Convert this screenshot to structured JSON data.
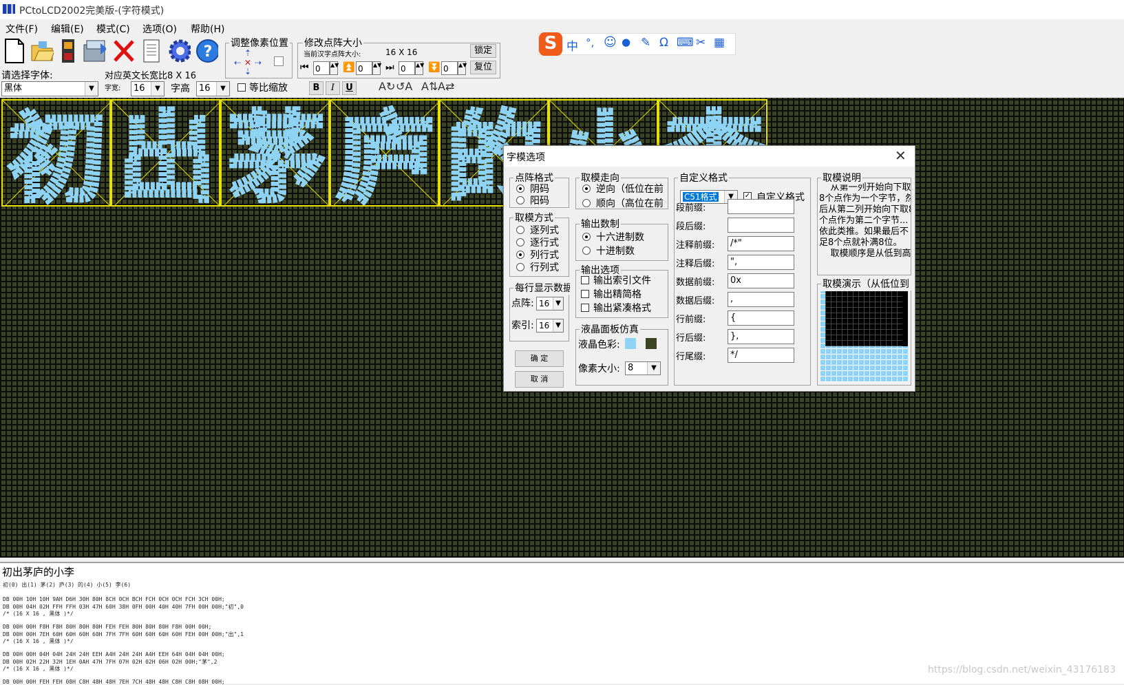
{
  "window": {
    "title": "PCtoLCD2002完美版-(字符模式)"
  },
  "menu": [
    "文件(F)",
    "编辑(E)",
    "模式(C)",
    "选项(O)",
    "帮助(H)"
  ],
  "toolbar": {
    "icons": [
      "new-file-icon",
      "open-folder-icon",
      "save-icon",
      "batch-generate-icon",
      "delete-icon",
      "document-icon",
      "settings-gear-icon",
      "help-icon"
    ],
    "adjust_pixel_title": "调整像素位置",
    "resize_title": "修改点阵大小",
    "current_size_label": "当前汉字点阵大小:",
    "current_size_value": "16 X 16",
    "lock_btn": "锁定",
    "reset_btn": "复位",
    "spin_values": [
      "0",
      "0",
      "0",
      "0"
    ],
    "font_select_label": "请选择字体:",
    "english_ratio_label": "对应英文长宽比8 X 16",
    "font_name": "黑体",
    "width_label": "字宽:",
    "width_value": "16",
    "height_label": "字高",
    "height_value": "16",
    "proportional_label": "等比缩放",
    "bold": "B",
    "italic": "I",
    "underline": "U"
  },
  "ime_bar": [
    "中",
    "°,",
    "☺",
    "🎤",
    "✎",
    "Ω",
    "⌨",
    "✂",
    "▦"
  ],
  "glyphs": [
    "初",
    "出",
    "茅",
    "庐",
    "的",
    "小",
    "李"
  ],
  "led_colors": {
    "on": "#8fd3f4",
    "off": "#3b4325",
    "frame": "#e8e000"
  },
  "dialog": {
    "title": "字模选项",
    "dot_format": {
      "title": "点阵格式",
      "options": [
        "阴码",
        "阳码"
      ],
      "selected": 0
    },
    "scan_mode": {
      "title": "取模方式",
      "options": [
        "逐列式",
        "逐行式",
        "列行式",
        "行列式"
      ],
      "selected": 2
    },
    "per_line": {
      "title": "每行显示数据",
      "dot_label": "点阵:",
      "dot_value": "16",
      "index_label": "索引:",
      "index_value": "16"
    },
    "ok": "确   定",
    "cancel": "取   消",
    "direction": {
      "title": "取模走向",
      "options": [
        "逆向（低位在前",
        "顺向（高位在前"
      ],
      "selected": 0
    },
    "number_base": {
      "title": "输出数制",
      "options": [
        "十六进制数",
        "十进制数"
      ],
      "selected": 0
    },
    "output_options": {
      "title": "输出选项",
      "options": [
        "输出索引文件",
        "输出精简格",
        "输出紧凑格式"
      ]
    },
    "lcd_sim": {
      "title": "液晶面板仿真",
      "color_label": "液晶色彩:",
      "pixel_label": "像素大小:",
      "pixel_value": "8"
    },
    "custom": {
      "title": "自定义格式",
      "format_value": "C51格式",
      "custom_check": "自定义格式",
      "rows": [
        {
          "label": "段前缀:",
          "value": ""
        },
        {
          "label": "段后缀:",
          "value": ""
        },
        {
          "label": "注释前缀:",
          "value": "/*\""
        },
        {
          "label": "注释后缀:",
          "value": "\","
        },
        {
          "label": "数据前缀:",
          "value": "0x"
        },
        {
          "label": "数据后缀:",
          "value": ","
        },
        {
          "label": "行前缀:",
          "value": "{"
        },
        {
          "label": "行后缀:",
          "value": "},"
        },
        {
          "label": "行尾缀:",
          "value": "*/"
        }
      ]
    },
    "explain": {
      "title": "取模说明",
      "text": "    从第一列开始向下取8个点作为一个字节，然后从第二列开始向下取8个点作为第二个字节...依此类推。如果最后不足8个点就补满8位。\n    取模顺序是从低到高"
    },
    "demo_title": "取模演示（从低位到"
  },
  "output": {
    "input_text": "初出茅庐的小李",
    "index_line": "初(0) 出(1) 茅(2) 庐(3) 的(4) 小(5) 李(6)",
    "code_lines": [
      "DB 00H 10H 10H 9AH D6H 30H 80H 8CH 0CH BCH FCH 0CH 0CH FCH 3CH 00H;",
      "DB 00H 04H 02H FFH FFH 03H 47H 60H 38H 0FH 00H 40H 40H 7FH 00H 00H;\"初\",0",
      "/* (16 X 16 , 黑体 )*/",
      "",
      "DB 00H 00H F8H F8H 80H 80H 80H FEH FEH 80H 80H 80H F8H 00H 00H;",
      "DB 00H 00H 7EH 60H 60H 60H 60H 7FH 7FH 60H 60H 60H 60H FEH 00H 00H;\"出\",1",
      "/* (16 X 16 , 黑体 )*/",
      "",
      "DB 00H 00H 04H 04H 24H 24H EEH A4H 24H 24H A4H EEH 64H 04H 04H 00H;",
      "DB 00H 02H 22H 32H 1EH 0AH 47H 7FH 07H 02H 02H 06H 02H 00H;\"茅\",2",
      "/* (16 X 16 , 黑体 )*/",
      "",
      "DB 00H 00H FEH FEH 08H C8H 48H 48H 7EH 7CH 48H 48H C8H C8H 08H 00H;"
    ]
  },
  "watermark": "https://blog.csdn.net/weixin_43176183"
}
